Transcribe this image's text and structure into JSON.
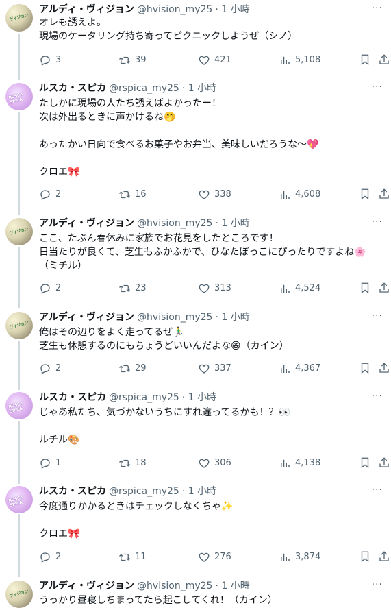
{
  "tweets": [
    {
      "author": "アルディ・ヴィジョン",
      "handle": "@hvision_my25",
      "time": "· 1 小時",
      "avatar_text": "ヴィジョン",
      "text": "オレも誘えよ。\n現場のケータリング持ち寄ってピクニックしようぜ（シノ）",
      "replies": "3",
      "retweets": "39",
      "likes": "421",
      "views": "5,108"
    },
    {
      "author": "ルスカ・スピカ",
      "handle": "@rspica_my25",
      "time": "· 1 小時",
      "avatar_text": "RUSCA SPICA",
      "text": "たしかに現場の人たち誘えばよかったー！\n次は外出るときに声かけるね🤭\n\nあったかい日向で食べるお菓子やお弁当、美味しいだろうな〜💖\n\nクロエ🎀",
      "replies": "2",
      "retweets": "16",
      "likes": "338",
      "views": "4,608"
    },
    {
      "author": "アルディ・ヴィジョン",
      "handle": "@hvision_my25",
      "time": "· 1 小時",
      "avatar_text": "ヴィジョン",
      "text": "ここ、たぶん春休みに家族でお花見をしたところです！\n日当たりが良くて、芝生もふかふかで、ひなたぼっこにぴったりですよね🌸\n（ミチル）",
      "replies": "2",
      "retweets": "23",
      "likes": "313",
      "views": "4,524"
    },
    {
      "author": "アルディ・ヴィジョン",
      "handle": "@hvision_my25",
      "time": "· 1 小時",
      "avatar_text": "ヴィジョン",
      "text": "俺はその辺りをよく走ってるぜ🏃‍♂️\n芝生も休憩するのにもちょうどいいんだよな😁（カイン）",
      "replies": "2",
      "retweets": "29",
      "likes": "337",
      "views": "4,367"
    },
    {
      "author": "ルスカ・スピカ",
      "handle": "@rspica_my25",
      "time": "· 1 小時",
      "avatar_text": "RUSCA SPICA",
      "text": "じゃあ私たち、気づかないうちにすれ違ってるかも！？👀\n\nルチル🎨",
      "replies": "1",
      "retweets": "18",
      "likes": "306",
      "views": "4,138"
    },
    {
      "author": "ルスカ・スピカ",
      "handle": "@rspica_my25",
      "time": "· 1 小時",
      "avatar_text": "RUSCA SPICA",
      "text": "今度通りかかるときはチェックしなくちゃ✨\n\nクロエ🎀",
      "replies": "2",
      "retweets": "11",
      "likes": "276",
      "views": "3,874"
    },
    {
      "author": "アルディ・ヴィジョン",
      "handle": "@hvision_my25",
      "time": "· 1 小時",
      "avatar_text": "ヴィジョン",
      "text": "うっかり昼寝しちまってたら起こしてくれ！（カイン）"
    }
  ],
  "more_label": "···",
  "colors": {
    "text": "#0f1419",
    "muted": "#536471",
    "line": "#cfd9de"
  }
}
